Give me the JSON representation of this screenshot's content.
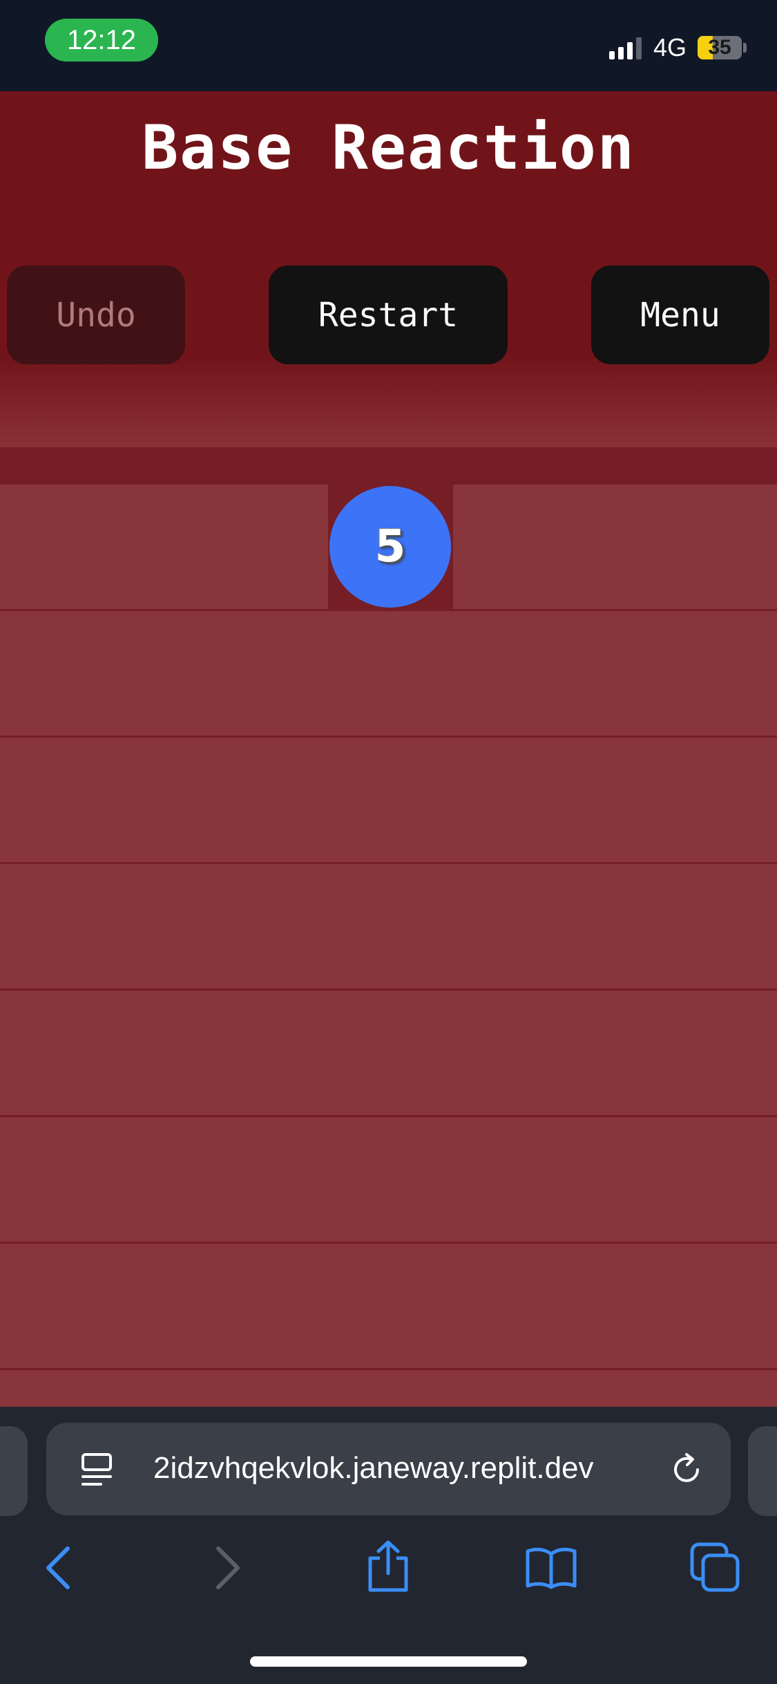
{
  "status_bar": {
    "time": "12:12",
    "network": "4G",
    "battery_percent": "35"
  },
  "game": {
    "title": "Base Reaction",
    "buttons": {
      "undo": "Undo",
      "restart": "Restart",
      "menu": "Menu"
    },
    "ball": {
      "value": "5",
      "color": "#3d74f7"
    },
    "colors": {
      "header_bg": "#71141a",
      "board_bg": "#761e26",
      "lane_bg": "#88363c"
    }
  },
  "browser": {
    "url": "2idzvhqekvlok.janeway.replit.dev",
    "accent": "#3a8ef6"
  }
}
